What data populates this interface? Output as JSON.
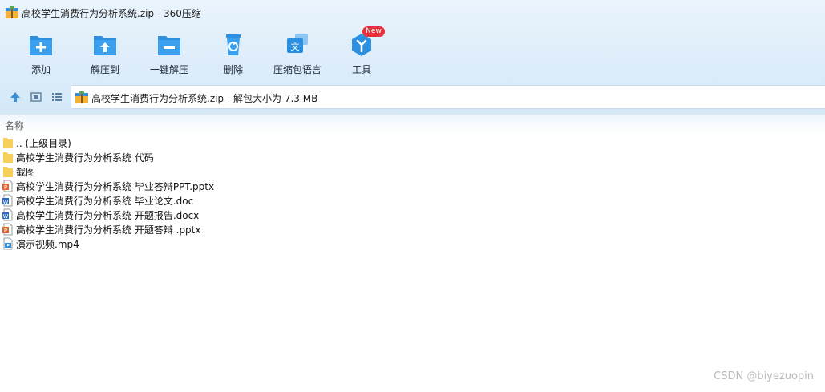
{
  "window": {
    "title": "高校学生消费行为分析系统.zip - 360压缩"
  },
  "toolbar": {
    "add_label": "添加",
    "extract_to_label": "解压到",
    "one_click_extract_label": "一键解压",
    "delete_label": "删除",
    "archive_language_label": "压缩包语言",
    "tools_label": "工具",
    "tools_badge": "New"
  },
  "address": {
    "text": "高校学生消费行为分析系统.zip - 解包大小为 7.3 MB"
  },
  "columns": {
    "name": "名称"
  },
  "files": [
    {
      "name": ".. (上级目录)",
      "icon": "folder-icon"
    },
    {
      "name": "高校学生消费行为分析系统 代码",
      "icon": "folder-icon"
    },
    {
      "name": "截图",
      "icon": "folder-icon"
    },
    {
      "name": "高校学生消费行为分析系统 毕业答辩PPT.pptx",
      "icon": "pptx-file-icon"
    },
    {
      "name": "高校学生消费行为分析系统 毕业论文.doc",
      "icon": "doc-file-icon"
    },
    {
      "name": "高校学生消费行为分析系统 开题报告.docx",
      "icon": "doc-file-icon"
    },
    {
      "name": "高校学生消费行为分析系统 开题答辩 .pptx",
      "icon": "pptx-file-icon"
    },
    {
      "name": "演示视频.mp4",
      "icon": "video-file-icon"
    }
  ],
  "watermark": "CSDN @biyezuopin",
  "colors": {
    "accent_blue": "#2d8fe0",
    "badge_red": "#e8303a",
    "folder_yellow": "#f7cf5a",
    "ppt_orange": "#e4632b"
  }
}
